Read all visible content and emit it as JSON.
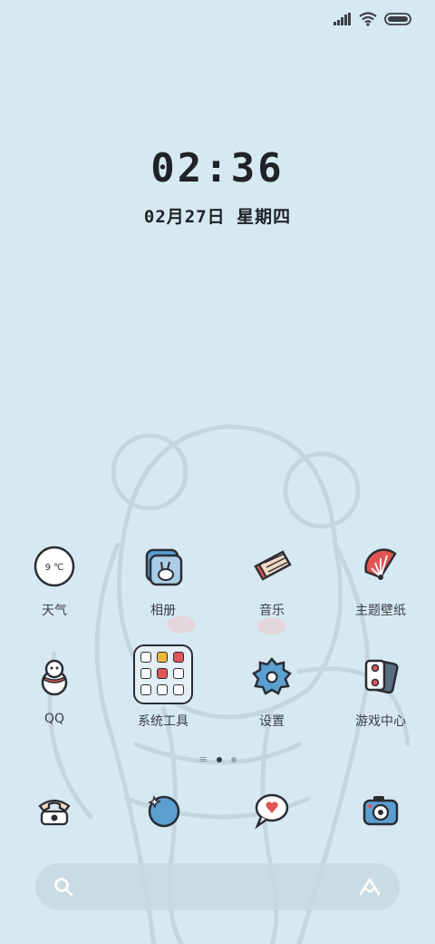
{
  "clock": {
    "time": "02:36",
    "date": "02月27日 星期四"
  },
  "apps_row1": [
    {
      "label": "天气",
      "icon": "weather-icon",
      "temp": "9 ℃"
    },
    {
      "label": "相册",
      "icon": "gallery-icon"
    },
    {
      "label": "音乐",
      "icon": "music-icon"
    },
    {
      "label": "主题壁纸",
      "icon": "themes-icon"
    }
  ],
  "apps_row2": [
    {
      "label": "QQ",
      "icon": "qq-penguin-icon"
    },
    {
      "label": "系统工具",
      "icon": "system-tools-folder-icon"
    },
    {
      "label": "设置",
      "icon": "settings-gear-icon"
    },
    {
      "label": "游戏中心",
      "icon": "game-center-icon"
    }
  ],
  "dock": [
    {
      "icon": "phone-icon"
    },
    {
      "icon": "browser-icon"
    },
    {
      "icon": "messages-icon"
    },
    {
      "icon": "camera-icon"
    }
  ],
  "page_indicator": {
    "count": 2,
    "active": 0
  },
  "colors": {
    "background": "#d6e9f3",
    "ink": "#2a2d33",
    "accent_red": "#e05454",
    "accent_blue": "#5b9fd1"
  }
}
